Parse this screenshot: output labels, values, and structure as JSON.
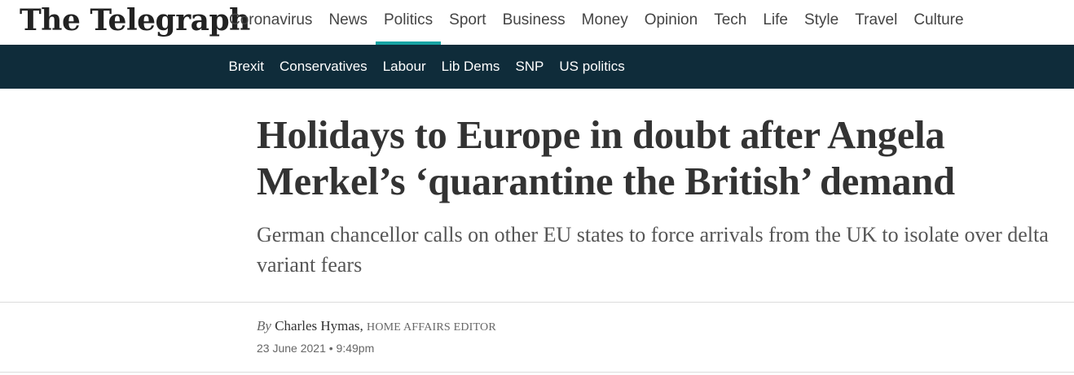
{
  "brand": {
    "logo_text": "The Telegraph"
  },
  "main_nav": {
    "items": [
      {
        "label": "Coronavirus"
      },
      {
        "label": "News"
      },
      {
        "label": "Politics",
        "active": true
      },
      {
        "label": "Sport"
      },
      {
        "label": "Business"
      },
      {
        "label": "Money"
      },
      {
        "label": "Opinion"
      },
      {
        "label": "Tech"
      },
      {
        "label": "Life"
      },
      {
        "label": "Style"
      },
      {
        "label": "Travel"
      },
      {
        "label": "Culture"
      }
    ],
    "active_indicator_color": "#18a4a4"
  },
  "sub_nav": {
    "background_color": "#0f2c3a",
    "items": [
      {
        "label": "Brexit"
      },
      {
        "label": "Conservatives"
      },
      {
        "label": "Labour"
      },
      {
        "label": "Lib Dems"
      },
      {
        "label": "SNP"
      },
      {
        "label": "US politics"
      }
    ]
  },
  "article": {
    "headline": "Holidays to Europe in doubt after Angela Merkel’s ‘quarantine the British’ demand",
    "standfirst": "German chancellor calls on other EU states to force arrivals from the UK to isolate over delta variant fears",
    "byline": {
      "prefix": "By",
      "author": "Charles Hymas,",
      "role": "HOME AFFAIRS EDITOR"
    },
    "date": "23 June 2021",
    "separator": "•",
    "time": "9:49pm"
  }
}
